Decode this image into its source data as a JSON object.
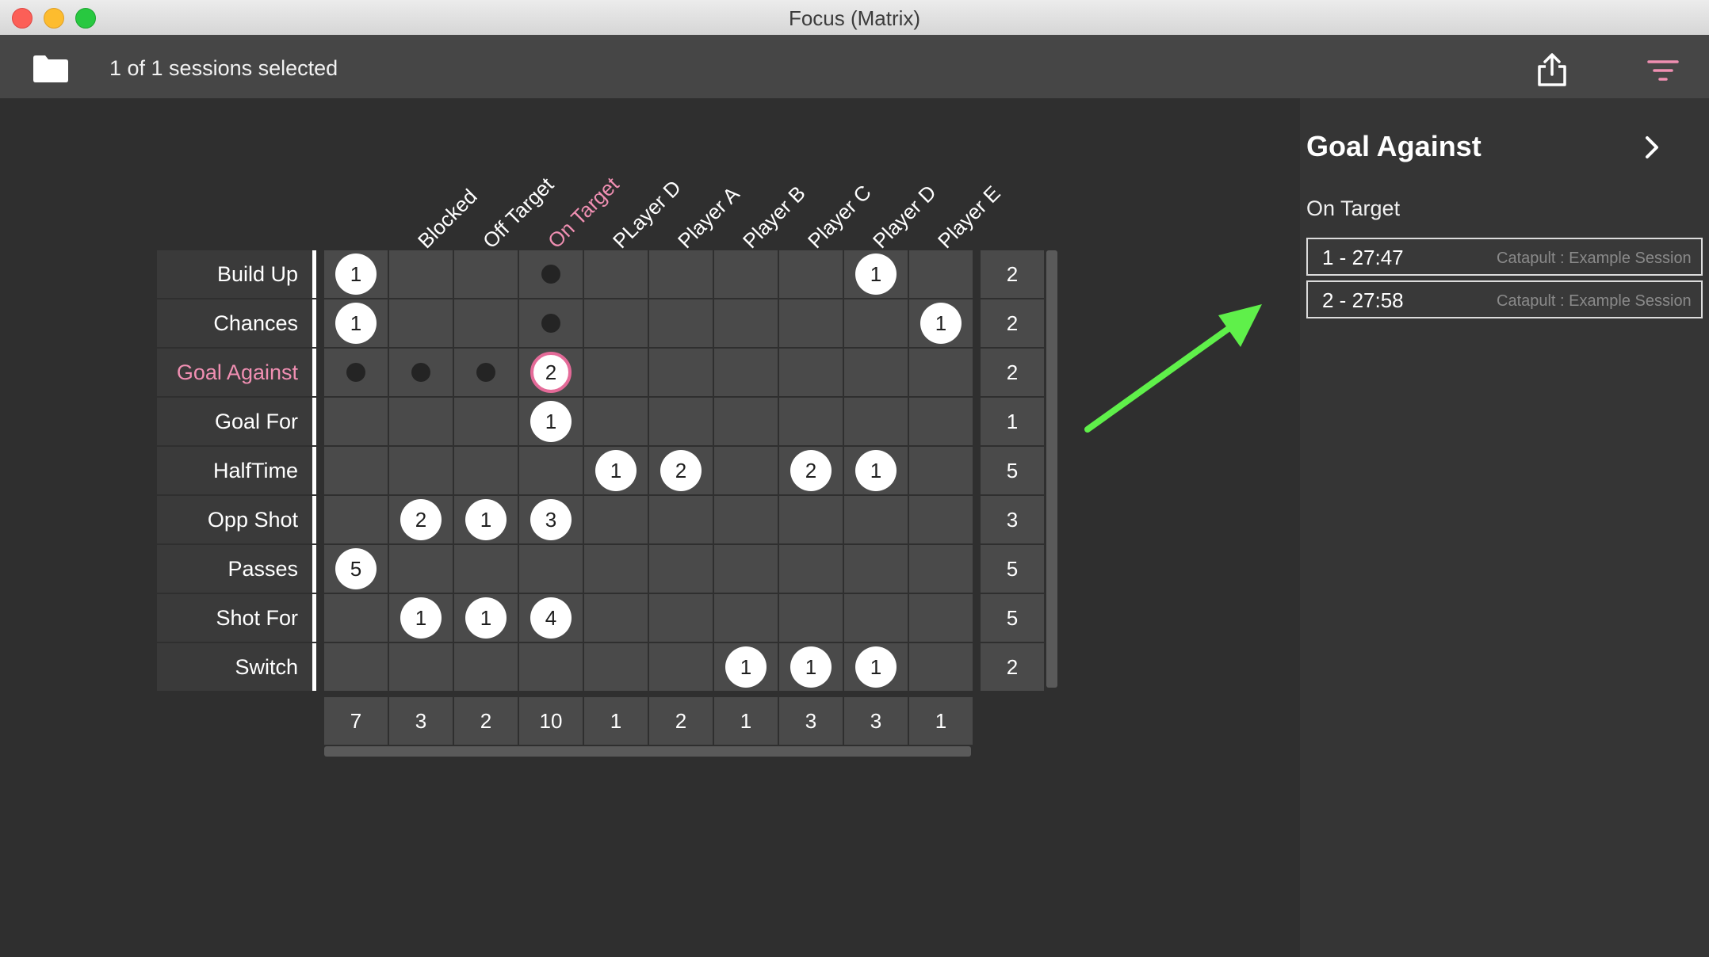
{
  "window": {
    "title": "Focus (Matrix)"
  },
  "toolbar": {
    "selection_text": "1 of 1 sessions selected",
    "folder_icon": "folder-icon",
    "share_icon": "share-icon",
    "filter_icon": "filter-icon",
    "filter_color": "#f08fb2"
  },
  "matrix": {
    "active_column": 2,
    "active_row": 2,
    "accent_color": "#f08fb2",
    "columns": [
      "Blocked",
      "Off Target",
      "On Target",
      "PLayer D",
      "Player A",
      "Player B",
      "Player C",
      "Player D",
      "Player E"
    ],
    "rows": [
      {
        "label": "Build Up",
        "cells": [
          1,
          null,
          null,
          "dot",
          null,
          null,
          null,
          null,
          1,
          null
        ],
        "total": "2"
      },
      {
        "label": "Chances",
        "cells": [
          1,
          null,
          null,
          "dot",
          null,
          null,
          null,
          null,
          null,
          1
        ],
        "total": "2"
      },
      {
        "label": "Goal Against",
        "cells": [
          "dot",
          "dot",
          "dot",
          2,
          null,
          null,
          null,
          null,
          null,
          null
        ],
        "total": "2"
      },
      {
        "label": "Goal For",
        "cells": [
          null,
          null,
          null,
          1,
          null,
          null,
          null,
          null,
          null,
          null
        ],
        "total": "1"
      },
      {
        "label": "HalfTime",
        "cells": [
          null,
          null,
          null,
          null,
          1,
          2,
          null,
          2,
          1,
          null
        ],
        "total": "5"
      },
      {
        "label": "Opp Shot",
        "cells": [
          null,
          2,
          1,
          3,
          null,
          null,
          null,
          null,
          null,
          null
        ],
        "total": "3"
      },
      {
        "label": "Passes",
        "cells": [
          5,
          null,
          null,
          null,
          null,
          null,
          null,
          null,
          null,
          null
        ],
        "total": "5"
      },
      {
        "label": "Shot For",
        "cells": [
          null,
          1,
          1,
          4,
          null,
          null,
          null,
          null,
          null,
          null
        ],
        "total": "5"
      },
      {
        "label": "Switch",
        "cells": [
          null,
          null,
          null,
          null,
          null,
          null,
          1,
          1,
          1,
          null
        ],
        "total": "2"
      }
    ],
    "column_totals": [
      "7",
      "3",
      "2",
      "10",
      "1",
      "2",
      "1",
      "3",
      "3",
      "1"
    ],
    "highlight": {
      "row": 2,
      "col": 3
    }
  },
  "panel": {
    "title": "Goal Against",
    "subtitle": "On Target",
    "chevron_icon": "chevron-right-icon",
    "events": [
      {
        "label": "1 - 27:47",
        "source": "Catapult : Example Session"
      },
      {
        "label": "2 - 27:58",
        "source": "Catapult : Example Session"
      }
    ]
  },
  "annotation": {
    "arrow_icon": "arrow-icon",
    "color": "#5ff04a"
  }
}
